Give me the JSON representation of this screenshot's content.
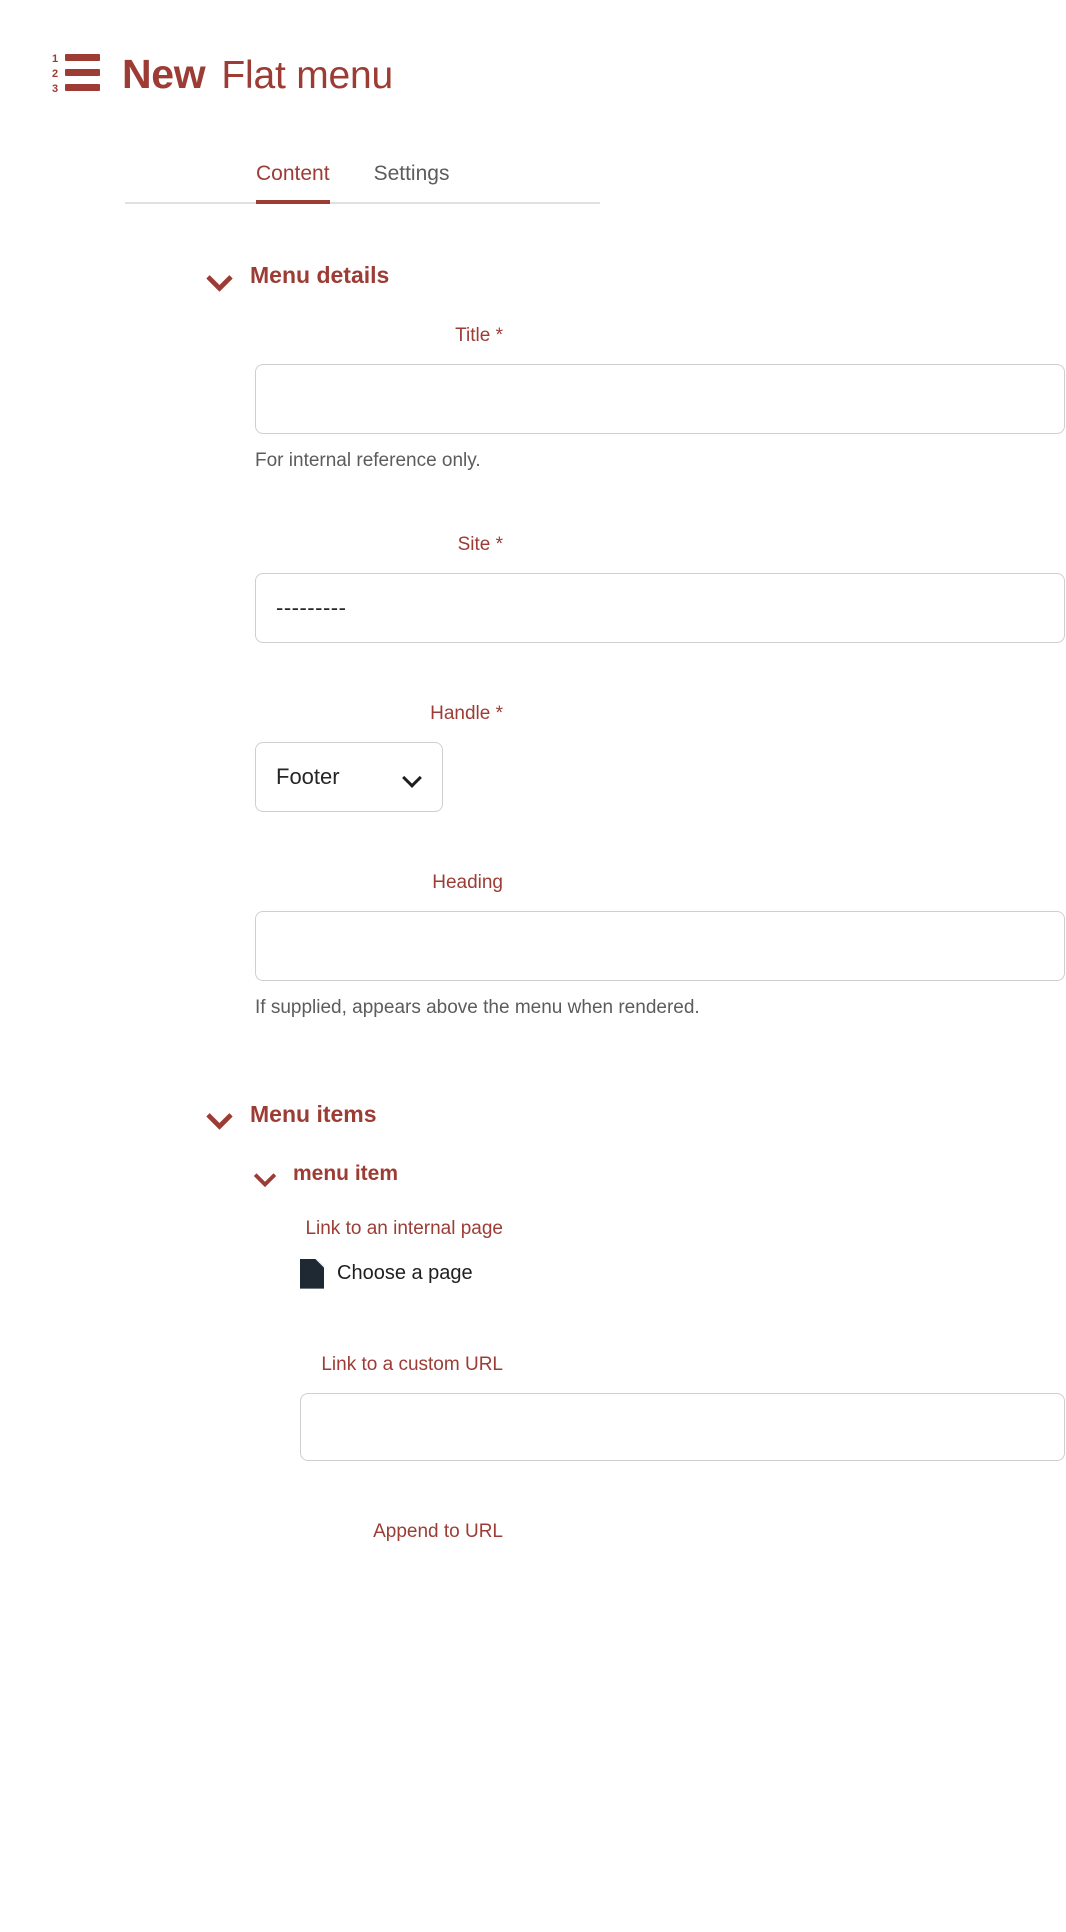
{
  "header": {
    "icon": "numbered-list-icon",
    "icon_numbers": [
      "1",
      "2",
      "3"
    ],
    "prefix": "New",
    "object_type": "Flat menu",
    "accent_color": "#9c3c35"
  },
  "tabs": [
    {
      "label": "Content",
      "active": true
    },
    {
      "label": "Settings",
      "active": false
    }
  ],
  "sections": [
    {
      "title": "Menu details",
      "expanded": true,
      "fields": [
        {
          "label": "Title",
          "required": true,
          "required_marker": "*",
          "type": "text",
          "value": "",
          "help": "For internal reference only."
        },
        {
          "label": "Site",
          "required": true,
          "required_marker": "*",
          "type": "select",
          "value": "---------",
          "help": ""
        },
        {
          "label": "Handle",
          "required": true,
          "required_marker": "*",
          "type": "select-compact",
          "value": "Footer",
          "help": ""
        },
        {
          "label": "Heading",
          "required": false,
          "required_marker": "",
          "type": "text",
          "value": "",
          "help": "If supplied, appears above the menu when rendered."
        }
      ]
    },
    {
      "title": "Menu items",
      "expanded": true,
      "items": [
        {
          "title": "menu item",
          "expanded": true,
          "fields": [
            {
              "label": "Link to an internal page",
              "type": "chooser",
              "button_label": "Choose a page",
              "button_icon": "document-icon"
            },
            {
              "label": "Link to a custom URL",
              "type": "text",
              "value": ""
            },
            {
              "label": "Append to URL",
              "type": "text",
              "value": ""
            }
          ]
        }
      ]
    }
  ]
}
